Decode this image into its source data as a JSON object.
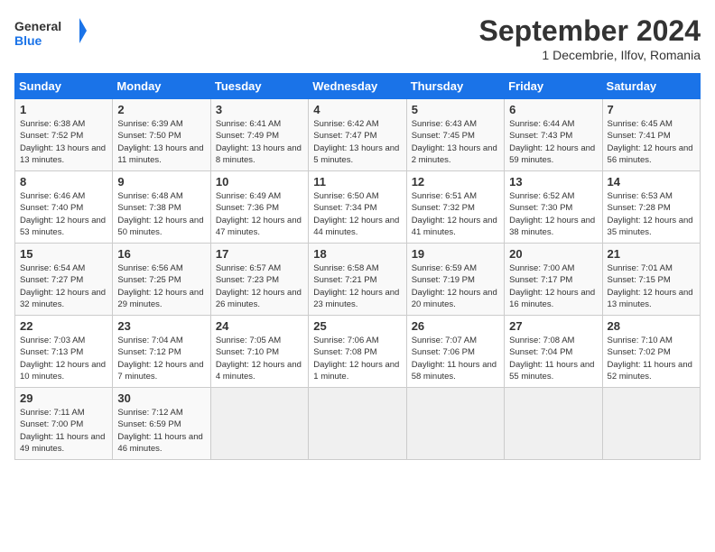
{
  "header": {
    "logo_line1": "General",
    "logo_line2": "Blue",
    "month_title": "September 2024",
    "subtitle": "1 Decembrie, Ilfov, Romania"
  },
  "weekdays": [
    "Sunday",
    "Monday",
    "Tuesday",
    "Wednesday",
    "Thursday",
    "Friday",
    "Saturday"
  ],
  "weeks": [
    [
      {
        "day": "1",
        "text": "Sunrise: 6:38 AM\nSunset: 7:52 PM\nDaylight: 13 hours and 13 minutes."
      },
      {
        "day": "2",
        "text": "Sunrise: 6:39 AM\nSunset: 7:50 PM\nDaylight: 13 hours and 11 minutes."
      },
      {
        "day": "3",
        "text": "Sunrise: 6:41 AM\nSunset: 7:49 PM\nDaylight: 13 hours and 8 minutes."
      },
      {
        "day": "4",
        "text": "Sunrise: 6:42 AM\nSunset: 7:47 PM\nDaylight: 13 hours and 5 minutes."
      },
      {
        "day": "5",
        "text": "Sunrise: 6:43 AM\nSunset: 7:45 PM\nDaylight: 13 hours and 2 minutes."
      },
      {
        "day": "6",
        "text": "Sunrise: 6:44 AM\nSunset: 7:43 PM\nDaylight: 12 hours and 59 minutes."
      },
      {
        "day": "7",
        "text": "Sunrise: 6:45 AM\nSunset: 7:41 PM\nDaylight: 12 hours and 56 minutes."
      }
    ],
    [
      {
        "day": "8",
        "text": "Sunrise: 6:46 AM\nSunset: 7:40 PM\nDaylight: 12 hours and 53 minutes."
      },
      {
        "day": "9",
        "text": "Sunrise: 6:48 AM\nSunset: 7:38 PM\nDaylight: 12 hours and 50 minutes."
      },
      {
        "day": "10",
        "text": "Sunrise: 6:49 AM\nSunset: 7:36 PM\nDaylight: 12 hours and 47 minutes."
      },
      {
        "day": "11",
        "text": "Sunrise: 6:50 AM\nSunset: 7:34 PM\nDaylight: 12 hours and 44 minutes."
      },
      {
        "day": "12",
        "text": "Sunrise: 6:51 AM\nSunset: 7:32 PM\nDaylight: 12 hours and 41 minutes."
      },
      {
        "day": "13",
        "text": "Sunrise: 6:52 AM\nSunset: 7:30 PM\nDaylight: 12 hours and 38 minutes."
      },
      {
        "day": "14",
        "text": "Sunrise: 6:53 AM\nSunset: 7:28 PM\nDaylight: 12 hours and 35 minutes."
      }
    ],
    [
      {
        "day": "15",
        "text": "Sunrise: 6:54 AM\nSunset: 7:27 PM\nDaylight: 12 hours and 32 minutes."
      },
      {
        "day": "16",
        "text": "Sunrise: 6:56 AM\nSunset: 7:25 PM\nDaylight: 12 hours and 29 minutes."
      },
      {
        "day": "17",
        "text": "Sunrise: 6:57 AM\nSunset: 7:23 PM\nDaylight: 12 hours and 26 minutes."
      },
      {
        "day": "18",
        "text": "Sunrise: 6:58 AM\nSunset: 7:21 PM\nDaylight: 12 hours and 23 minutes."
      },
      {
        "day": "19",
        "text": "Sunrise: 6:59 AM\nSunset: 7:19 PM\nDaylight: 12 hours and 20 minutes."
      },
      {
        "day": "20",
        "text": "Sunrise: 7:00 AM\nSunset: 7:17 PM\nDaylight: 12 hours and 16 minutes."
      },
      {
        "day": "21",
        "text": "Sunrise: 7:01 AM\nSunset: 7:15 PM\nDaylight: 12 hours and 13 minutes."
      }
    ],
    [
      {
        "day": "22",
        "text": "Sunrise: 7:03 AM\nSunset: 7:13 PM\nDaylight: 12 hours and 10 minutes."
      },
      {
        "day": "23",
        "text": "Sunrise: 7:04 AM\nSunset: 7:12 PM\nDaylight: 12 hours and 7 minutes."
      },
      {
        "day": "24",
        "text": "Sunrise: 7:05 AM\nSunset: 7:10 PM\nDaylight: 12 hours and 4 minutes."
      },
      {
        "day": "25",
        "text": "Sunrise: 7:06 AM\nSunset: 7:08 PM\nDaylight: 12 hours and 1 minute."
      },
      {
        "day": "26",
        "text": "Sunrise: 7:07 AM\nSunset: 7:06 PM\nDaylight: 11 hours and 58 minutes."
      },
      {
        "day": "27",
        "text": "Sunrise: 7:08 AM\nSunset: 7:04 PM\nDaylight: 11 hours and 55 minutes."
      },
      {
        "day": "28",
        "text": "Sunrise: 7:10 AM\nSunset: 7:02 PM\nDaylight: 11 hours and 52 minutes."
      }
    ],
    [
      {
        "day": "29",
        "text": "Sunrise: 7:11 AM\nSunset: 7:00 PM\nDaylight: 11 hours and 49 minutes."
      },
      {
        "day": "30",
        "text": "Sunrise: 7:12 AM\nSunset: 6:59 PM\nDaylight: 11 hours and 46 minutes."
      },
      {
        "day": "",
        "text": ""
      },
      {
        "day": "",
        "text": ""
      },
      {
        "day": "",
        "text": ""
      },
      {
        "day": "",
        "text": ""
      },
      {
        "day": "",
        "text": ""
      }
    ]
  ]
}
